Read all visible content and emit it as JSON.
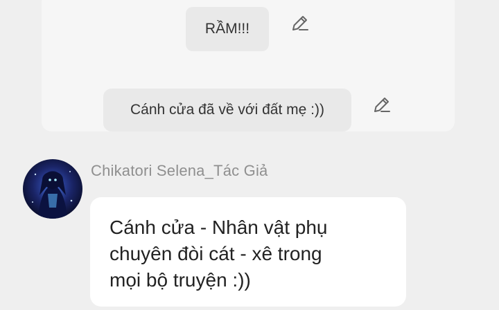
{
  "thread": {
    "messages": [
      {
        "text": "RẦM!!!"
      },
      {
        "text": "Cánh cửa đã về với đất mẹ :))"
      }
    ]
  },
  "reply": {
    "author": "Chikatori Selena_Tác Giả",
    "lines": [
      "Cánh cửa - Nhân vật phụ",
      "chuyên đòi cát - xê trong",
      "mọi bộ truyện :))"
    ]
  },
  "icons": {
    "edit": "pencil-icon",
    "avatar": "avatar-image"
  },
  "colors": {
    "page_background": "#efefef",
    "card_background": "#f6f6f6",
    "bubble_background": "#e9e9e9",
    "reply_bubble": "#ffffff",
    "author_text": "#8f8f8f"
  }
}
